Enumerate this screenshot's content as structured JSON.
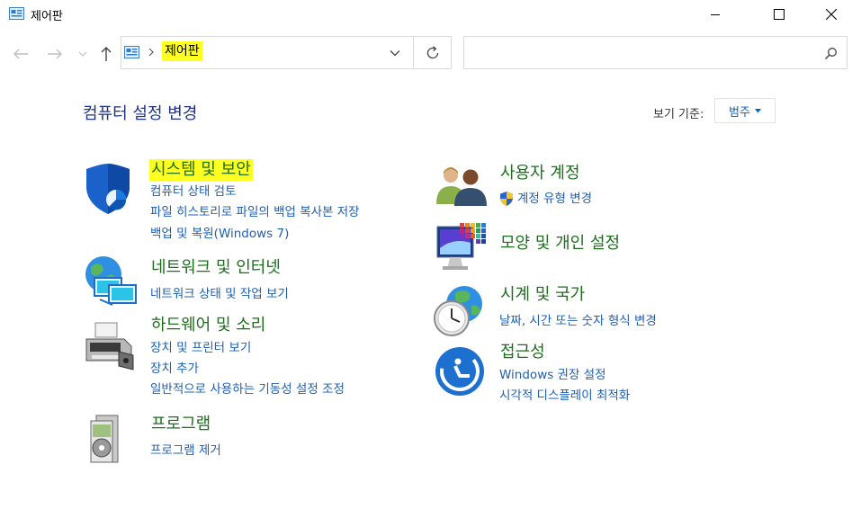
{
  "window": {
    "title": "제어판"
  },
  "address": {
    "breadcrumb": "제어판"
  },
  "search": {
    "placeholder": ""
  },
  "header": {
    "title": "컴퓨터 설정 변경",
    "view_by_label": "보기 기준:",
    "view_by_value": "범주"
  },
  "categories_left": [
    {
      "title": "시스템 및 보안",
      "links": [
        "컴퓨터 상태 검토",
        "파일 히스토리로 파일의 백업 복사본 저장",
        "백업 및 복원(Windows 7)"
      ]
    },
    {
      "title": "네트워크 및 인터넷",
      "links": [
        "네트워크 상태 및 작업 보기"
      ]
    },
    {
      "title": "하드웨어 및 소리",
      "links": [
        "장치 및 프린터 보기",
        "장치 추가",
        "일반적으로 사용하는 기동성 설정 조정"
      ]
    },
    {
      "title": "프로그램",
      "links": [
        "프로그램 제거"
      ]
    }
  ],
  "categories_right": [
    {
      "title": "사용자 계정",
      "links": [
        "계정 유형 변경"
      ]
    },
    {
      "title": "모양 및 개인 설정",
      "links": []
    },
    {
      "title": "시계 및 국가",
      "links": [
        "날짜, 시간 또는 숫자 형식 변경"
      ]
    },
    {
      "title": "접근성",
      "links": [
        "Windows 권장 설정",
        "시각적 디스플레이 최적화"
      ]
    }
  ],
  "icons": {
    "app": "control-panel-icon",
    "minimize": "minimize-icon",
    "maximize": "maximize-icon",
    "close": "close-icon",
    "back": "back-arrow-icon",
    "forward": "forward-arrow-icon",
    "recent": "chevron-down-icon",
    "up": "up-arrow-icon",
    "refresh": "refresh-icon",
    "search": "search-icon"
  },
  "colors": {
    "highlight": "#ffff22",
    "category_title": "#1e6e1e",
    "link": "#1e5fb4",
    "page_title": "#1e3287"
  }
}
